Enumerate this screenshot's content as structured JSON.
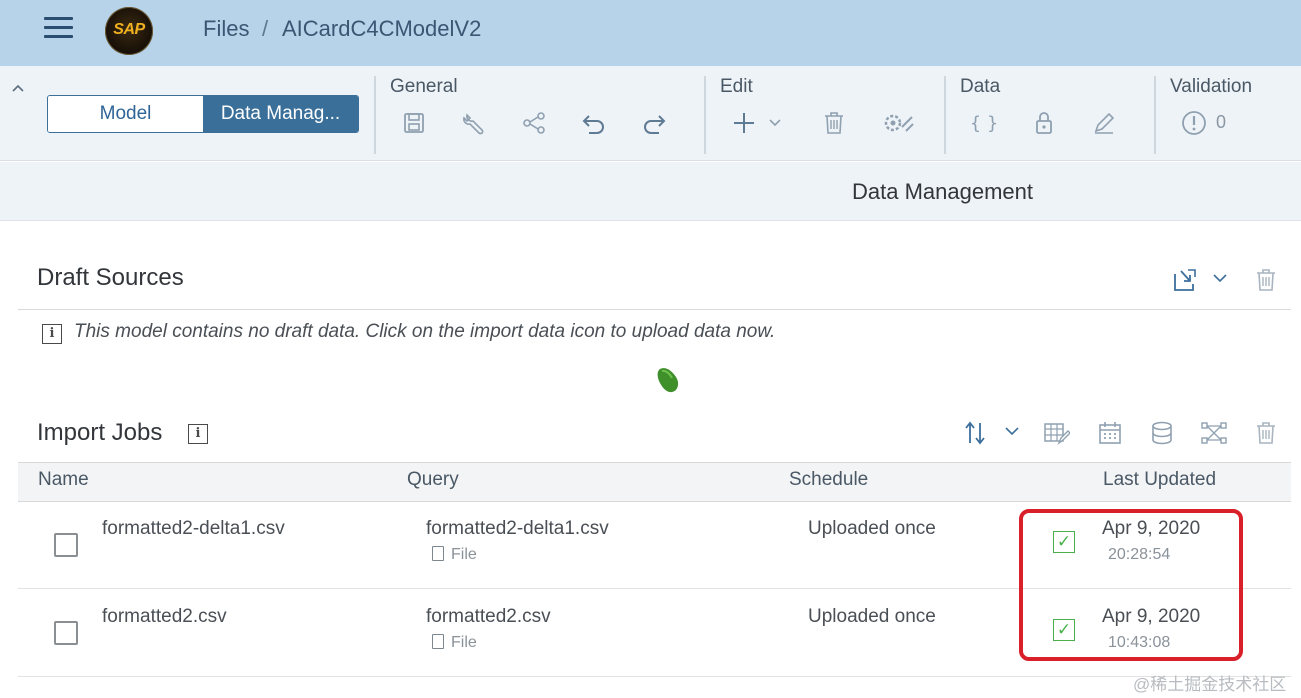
{
  "shell": {
    "logo_text": "SAP",
    "breadcrumb": {
      "root": "Files",
      "separator": "/",
      "current": "AICardC4CModelV2"
    }
  },
  "toolbar": {
    "tabs": [
      {
        "label": "Model",
        "selected": false
      },
      {
        "label": "Data Manag...",
        "selected": true
      }
    ],
    "groups": {
      "general": {
        "title": "General",
        "icons": [
          "save-icon",
          "wrench-icon",
          "share-icon",
          "undo-icon",
          "redo-icon"
        ]
      },
      "edit": {
        "title": "Edit",
        "icons": [
          "add-icon",
          "chevron-down-icon",
          "delete-icon",
          "manage-icon"
        ]
      },
      "data": {
        "title": "Data",
        "icons": [
          "formula-icon",
          "lock-icon",
          "pen-icon"
        ]
      },
      "validation": {
        "title": "Validation",
        "icons": [
          "alert-icon"
        ],
        "count": "0"
      }
    },
    "colors": {
      "accent": "#3a6f99",
      "shell": "#b7d3ea",
      "toolbar_bg": "#eef3f7"
    }
  },
  "page": {
    "title": "Data Management"
  },
  "draft_sources": {
    "title": "Draft Sources",
    "message": "This model contains no draft data. Click on the import data icon to upload data now.",
    "icons": [
      "import-data-icon",
      "chevron-down-icon",
      "delete-icon"
    ]
  },
  "import_jobs": {
    "title": "Import Jobs",
    "toolbar_icons": [
      "sort-icon",
      "chevron-down-icon",
      "edit-table-icon",
      "calendar-icon",
      "database-icon",
      "network-icon",
      "delete-icon"
    ],
    "columns": [
      "Name",
      "Query",
      "Schedule",
      "Last Updated"
    ],
    "rows": [
      {
        "name": "formatted2-delta1.csv",
        "query": "formatted2-delta1.csv",
        "query_type": "File",
        "schedule": "Uploaded once",
        "status": "success",
        "date": "Apr 9, 2020",
        "time": "20:28:54"
      },
      {
        "name": "formatted2.csv",
        "query": "formatted2.csv",
        "query_type": "File",
        "schedule": "Uploaded once",
        "status": "success",
        "date": "Apr 9, 2020",
        "time": "10:43:08"
      }
    ]
  },
  "watermark": "@稀土掘金技术社区"
}
